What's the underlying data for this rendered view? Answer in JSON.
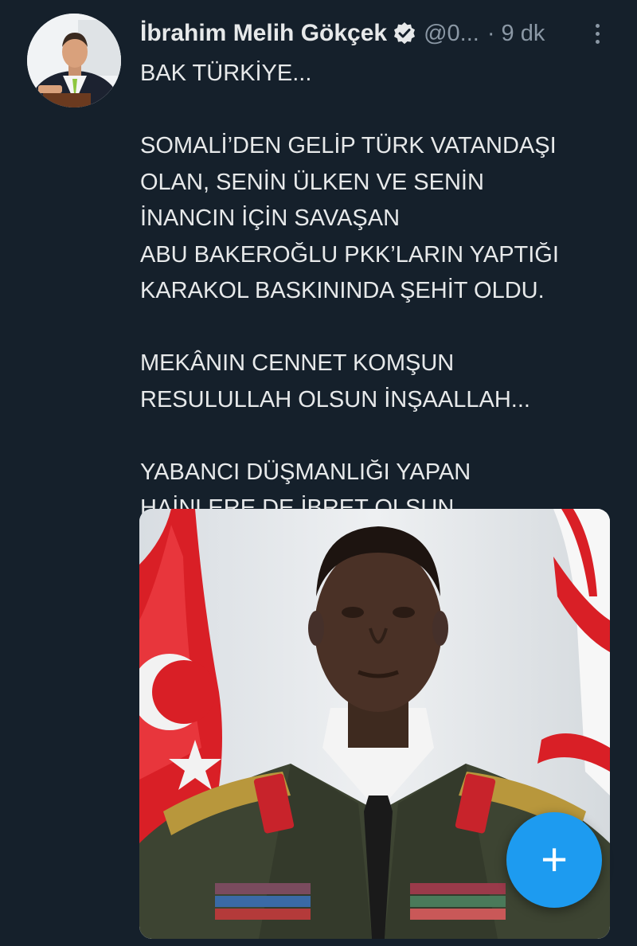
{
  "author": {
    "display_name": "İbrahim Melih Gökçek",
    "handle": "@0...",
    "separator": "·",
    "time": "9 dk",
    "verified": true
  },
  "tweet": {
    "lines": [
      "BAK TÜRKİYE...",
      "",
      "SOMALİ’DEN GELİP TÜRK VATANDAŞI",
      "OLAN, SENİN ÜLKEN VE SENİN",
      "İNANCIN İÇİN SAVAŞAN",
      "ABU BAKEROĞLU PKK’LARIN YAPTIĞI",
      "KARAKOL BASKININDA ŞEHİT OLDU.",
      "",
      "MEKÂNIN CENNET KOMŞUN",
      "RESULULLAH OLSUN İNŞAALLAH...",
      "",
      "YABANCI DÜŞMANLIĞI YAPAN",
      "HAİNLERE DE İBRET OLSUN..."
    ]
  },
  "icons": {
    "verified": "verified-badge-icon",
    "more": "more-vertical-icon",
    "compose": "plus-icon"
  },
  "fab": {
    "label": "+"
  },
  "colors": {
    "background": "#15202b",
    "text": "#e7e9ea",
    "muted": "#8b98a5",
    "accent": "#1d9bf0"
  }
}
